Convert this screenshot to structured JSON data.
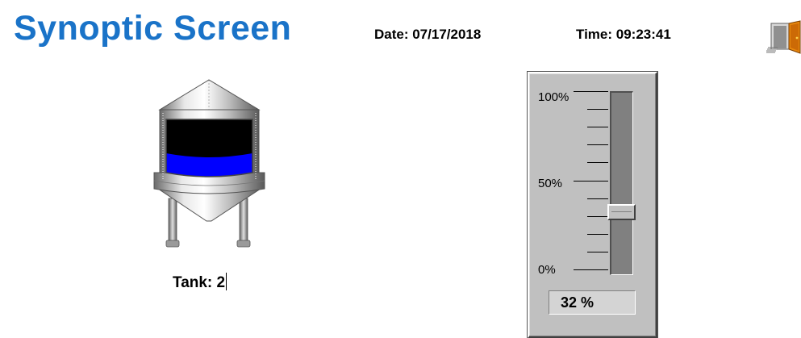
{
  "header": {
    "title": "Synoptic Screen",
    "date_text": "Date: 07/17/2018",
    "time_text": "Time: 09:23:41"
  },
  "toolbar": {
    "exit_icon": "exit-door-icon"
  },
  "tank": {
    "label": "Tank: 2",
    "level_percent": 32,
    "icon": "storage-tank-icon",
    "colors": {
      "fluid": "#0000ff",
      "empty": "#000000",
      "body": "#c0c0c0"
    }
  },
  "gauge": {
    "label_top": "100%",
    "label_mid": "50%",
    "label_bottom": "0%",
    "value_percent": 32,
    "readout": "32 %"
  },
  "colors": {
    "title": "#1a73c8",
    "panel": "#c0c0c0"
  }
}
